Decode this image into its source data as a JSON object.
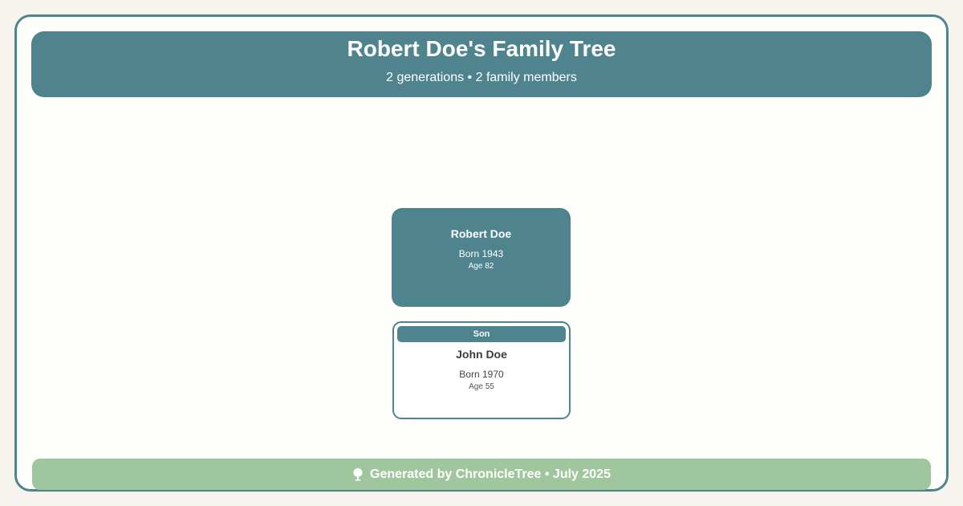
{
  "header": {
    "title": "Robert Doe's Family Tree",
    "subtitle": "2 generations • 2 family members"
  },
  "root_person": {
    "name": "Robert Doe",
    "born": "Born 1943",
    "age": "Age 82"
  },
  "children": [
    {
      "relation": "Son",
      "name": "John Doe",
      "born": "Born 1970",
      "age": "Age 55"
    }
  ],
  "footer": {
    "icon": "tree-icon",
    "text": "Generated by ChronicleTree • July 2025"
  },
  "colors": {
    "primary": "#4f848e",
    "footer": "#a0c69d",
    "background": "#fefefb",
    "page": "#f7f3ef"
  }
}
